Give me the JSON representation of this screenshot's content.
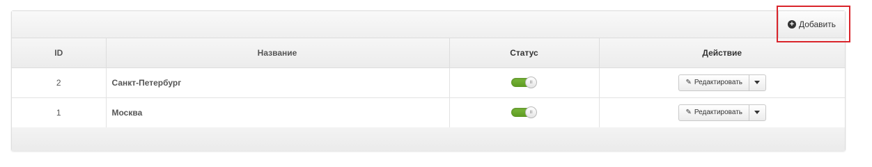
{
  "header": {
    "add_label": "Добавить"
  },
  "table": {
    "columns": [
      "ID",
      "Название",
      "Статус",
      "Действие"
    ],
    "rows": [
      {
        "id": "2",
        "name": "Санкт-Петербург",
        "status_on": true,
        "action_label": "Редактировать"
      },
      {
        "id": "1",
        "name": "Москва",
        "status_on": true,
        "action_label": "Редактировать"
      }
    ]
  },
  "icons": {
    "add": "plus-circle-icon",
    "edit": "pencil-icon",
    "dropdown": "caret-down-icon"
  },
  "colors": {
    "toggle_on": "#6aa82c",
    "highlight": "#d9242b"
  }
}
